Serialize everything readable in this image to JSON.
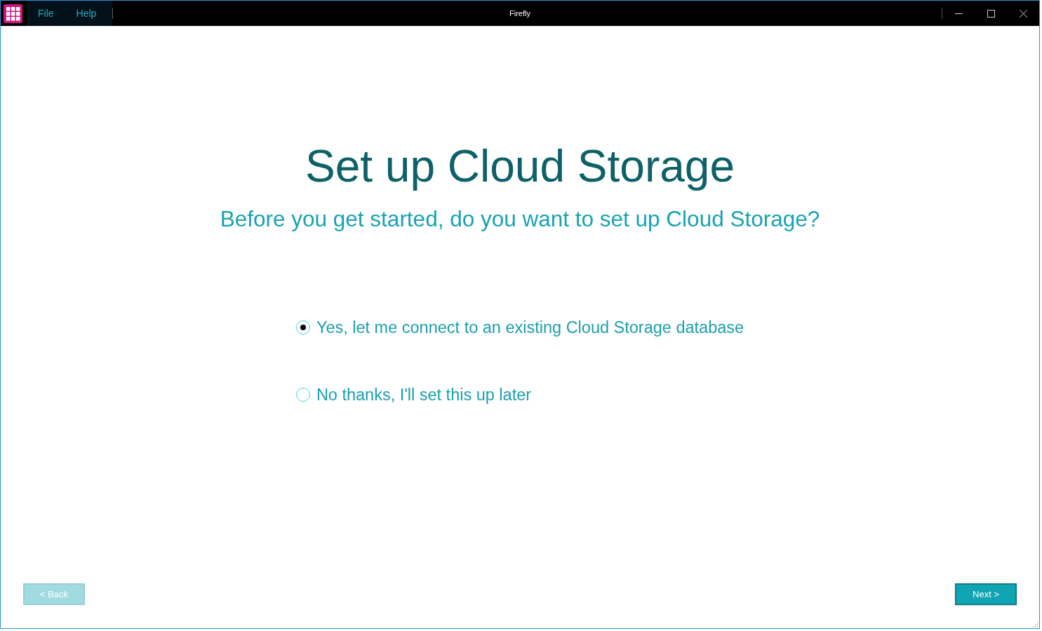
{
  "window": {
    "title": "Firefly",
    "menu": [
      {
        "label": "File"
      },
      {
        "label": "Help"
      }
    ]
  },
  "heading": "Set up Cloud Storage",
  "subheading": "Before you get started, do you want to set up Cloud Storage?",
  "options": [
    {
      "label": "Yes, let me connect to an existing Cloud Storage database",
      "selected": true
    },
    {
      "label": "No thanks, I'll set this up later",
      "selected": false
    }
  ],
  "buttons": [
    {
      "label": "< Back",
      "disabled": true
    },
    {
      "label": "Next >",
      "disabled": false
    }
  ]
}
